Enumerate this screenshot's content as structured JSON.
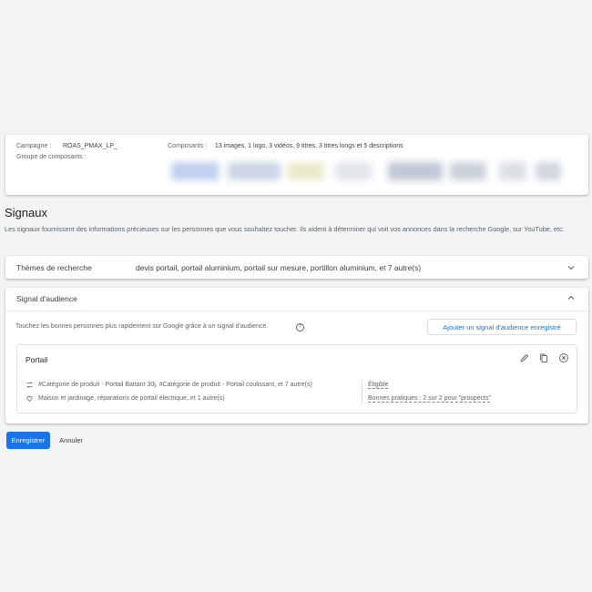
{
  "summary": {
    "campaign_label": "Campagne :",
    "campaign_value": "ROAS_PMAX_LP_",
    "group_label": "Groupe de composants :",
    "components_label": "Composants :",
    "components_value": "13 images, 1 logo, 3 vidéos, 9 titres, 3 titres longs et 5 descriptions"
  },
  "signals": {
    "title": "Signaux",
    "description": "Les signaux fournissent des informations précieuses sur les personnes que vous souhaitez toucher. Ils aident à déterminer qui voit vos annonces dans la recherche Google, sur YouTube, etc."
  },
  "search_themes": {
    "label": "Thèmes de recherche",
    "value": "devis portail, portail aluminium, portail sur mesure, portillon aluminium, et 7 autre(s)",
    "chevron_icon": "chevron-down-icon"
  },
  "audience_signal": {
    "label": "Signal d'audience",
    "chevron_icon": "chevron-up-icon",
    "hint": "Touchez les bonnes personnes plus rapidement sur Google grâce à un signal d'audience.",
    "add_button": "Ajouter un signal d'audience enregistré",
    "signal": {
      "name": "Portail",
      "segments": "#Catégorie de produit - Portail Battant 30j, #Catégorie de produit - Portail coulissant, et 7 autre(s)",
      "interests": "Maison et jardinage, réparations de portail électrique, et 1 autre(s)",
      "status": "Éligible",
      "best_practices": "Bonnes pratiques : 2 sur 2 pour \"prospects\""
    }
  },
  "actions": {
    "save": "Enregistrer",
    "cancel": "Annuler"
  },
  "colors": {
    "primary": "#1a73e8",
    "background": "#f1f3f4",
    "text": "#3c4043"
  }
}
